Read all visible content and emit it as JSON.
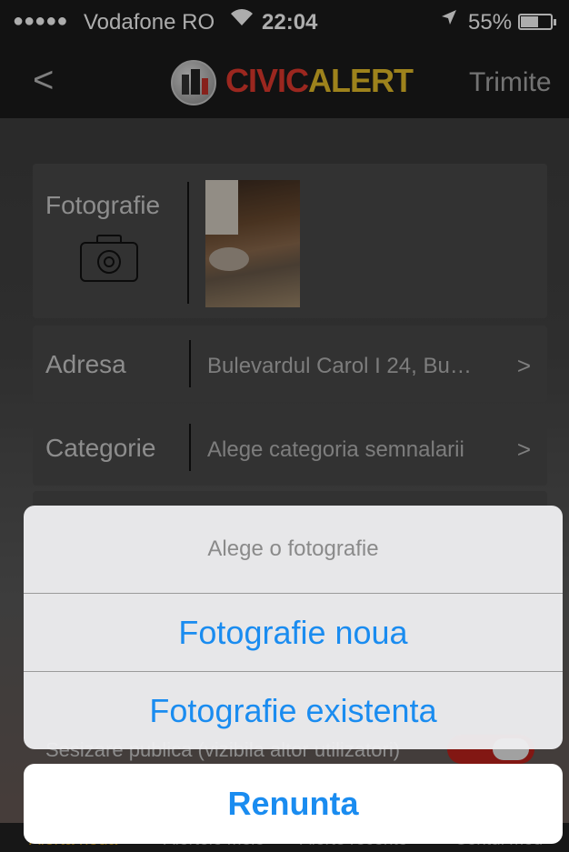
{
  "status_bar": {
    "signal": "●●●●●",
    "carrier": "Vodafone RO",
    "wifi_icon": "wifi-icon",
    "time": "22:04",
    "location_icon": "location-arrow-icon",
    "battery_percent": "55%",
    "battery_level": 0.55
  },
  "nav": {
    "back": "<",
    "logo_civic": "CIVIC",
    "logo_alert": "ALERT",
    "send": "Trimite"
  },
  "form": {
    "photo_label": "Fotografie",
    "address_label": "Adresa",
    "address_value": "Bulevardul Carol I 24, Bu…",
    "category_label": "Categorie",
    "category_value": "Alege categoria semnalarii",
    "chevron": ">",
    "public_label": "Sesizare publica (vizibila altor utilizatori)"
  },
  "action_sheet": {
    "title": "Alege o fotografie",
    "option_new": "Fotografie noua",
    "option_existing": "Fotografie existenta",
    "cancel": "Renunta"
  },
  "tabs": [
    {
      "label": "Alerta noua",
      "active": true
    },
    {
      "label": "Alertele mele",
      "active": false
    },
    {
      "label": "Alerte recente",
      "active": false
    },
    {
      "label": "Contul meu",
      "active": false
    }
  ],
  "colors": {
    "accent_blue": "#1a8cf0",
    "brand_red": "#e53a2e",
    "brand_yellow": "#e8c02a",
    "toggle_on": "#c0221d"
  }
}
